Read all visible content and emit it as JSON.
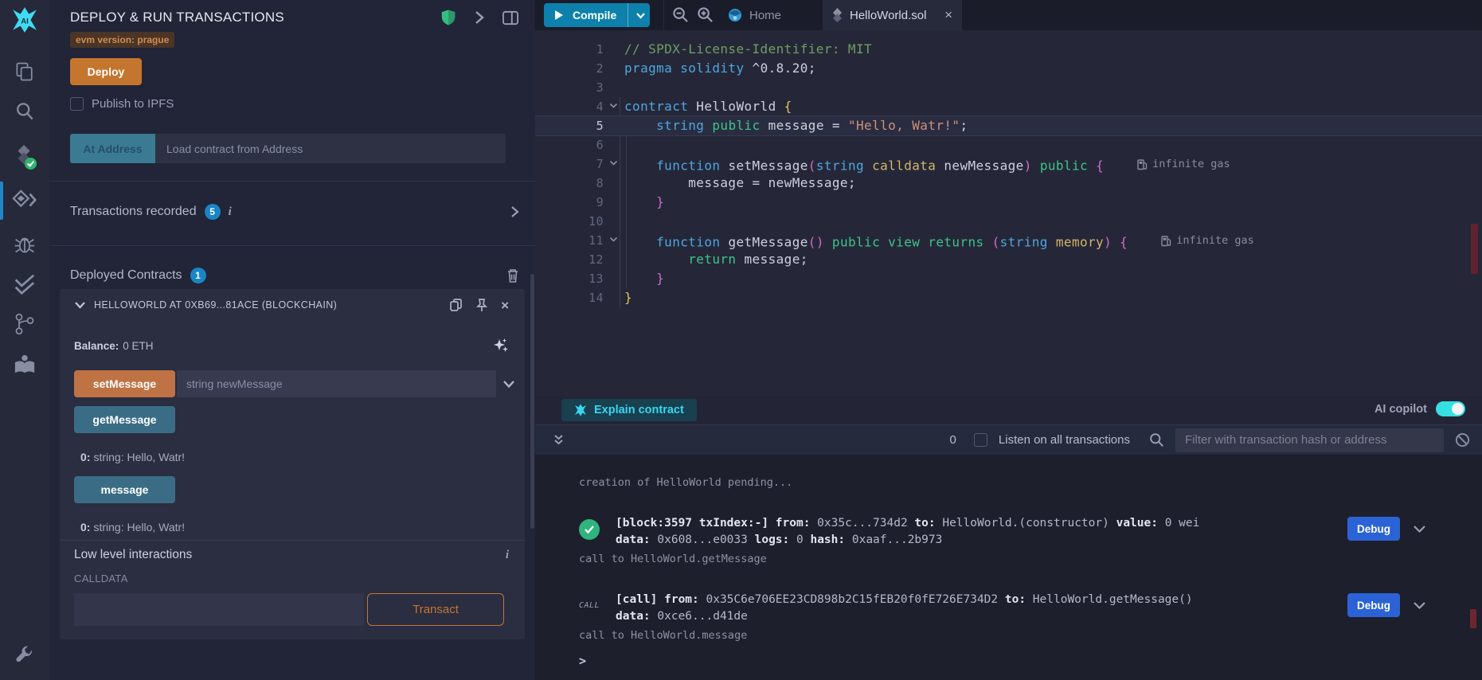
{
  "colors": {
    "accent_orange": "#c4762f",
    "teal_button": "#3a6d85",
    "compile_blue": "#0d81ab",
    "cyan_ai": "#38d6f2",
    "debug_blue": "#2b63d7",
    "badge_blue": "#1a85c4",
    "success_green": "#2eb47c",
    "shield_green": "#35bd81"
  },
  "sidebar": {
    "icons": [
      "remix-ai-logo",
      "file-explorer",
      "search",
      "solidity-compiler",
      "deploy-and-run",
      "debugger",
      "static-analysis",
      "git",
      "learneth",
      "settings-wrench"
    ],
    "active_item": "deploy-and-run"
  },
  "panel": {
    "title": "DEPLOY & RUN TRANSACTIONS",
    "header_icons": [
      "shield-icon",
      "chevron-right-icon",
      "columns-icon"
    ],
    "evm_badge": "evm version: prague",
    "deploy_label": "Deploy",
    "publish_label": "Publish to IPFS",
    "at_address_label": "At Address",
    "at_address_placeholder": "Load contract from Address",
    "transactions_recorded": {
      "label": "Transactions recorded",
      "count": "5",
      "info_glyph": "i"
    },
    "deployed_contracts": {
      "label": "Deployed Contracts",
      "count": "1"
    },
    "contract": {
      "header": "HELLOWORLD AT 0XB69...81ACE (BLOCKCHAIN)",
      "balance_label": "Balance:",
      "balance_value": "0 ETH",
      "set_message_label": "setMessage",
      "set_message_placeholder": "string newMessage",
      "get_message_label": "getMessage",
      "get_message_result_index": "0:",
      "get_message_result": "string: Hello, Watr!",
      "message_label": "message",
      "message_result_index": "0:",
      "message_result": "string: Hello, Watr!",
      "low_level_label": "Low level interactions",
      "low_level_info_glyph": "i",
      "calldata_label": "CALLDATA",
      "transact_label": "Transact"
    }
  },
  "tabbar": {
    "compile_label": "Compile",
    "home_label": "Home",
    "file_label": "HelloWorld.sol",
    "close_glyph": "×",
    "icons": [
      "play-icon",
      "chevron-down-icon",
      "zoom-out-icon",
      "zoom-in-icon",
      "remix-home-icon",
      "solidity-file-icon",
      "close-icon"
    ]
  },
  "editor": {
    "active_line": 5,
    "fold_lines": [
      4,
      7,
      11
    ],
    "gas_lines": [
      7,
      11
    ],
    "gas_label": "infinite gas",
    "lines": [
      {
        "n": 1,
        "segs": [
          [
            "// SPDX-License-Identifier: MIT",
            "tok-com"
          ]
        ]
      },
      {
        "n": 2,
        "segs": [
          [
            "pragma solidity ",
            "tok-kw"
          ],
          [
            "^0.8.20;",
            ""
          ]
        ]
      },
      {
        "n": 3,
        "segs": []
      },
      {
        "n": 4,
        "segs": [
          [
            "contract ",
            "tok-kw"
          ],
          [
            "HelloWorld ",
            ""
          ],
          [
            "{",
            "tok-yel"
          ]
        ]
      },
      {
        "n": 5,
        "segs": [
          [
            "    ",
            ""
          ],
          [
            "string",
            "tok-kw"
          ],
          [
            " ",
            ""
          ],
          [
            "public",
            "tok-grn"
          ],
          [
            " message = ",
            ""
          ],
          [
            "\"Hello, Watr!\"",
            "tok-str"
          ],
          [
            ";",
            ""
          ]
        ]
      },
      {
        "n": 6,
        "segs": []
      },
      {
        "n": 7,
        "segs": [
          [
            "    ",
            ""
          ],
          [
            "function",
            "tok-kw"
          ],
          [
            " setMessage",
            ""
          ],
          [
            "(",
            "tok-mag"
          ],
          [
            "string",
            "tok-kw"
          ],
          [
            " ",
            ""
          ],
          [
            "calldata",
            "tok-khk"
          ],
          [
            " newMessage",
            ""
          ],
          [
            ")",
            "tok-mag"
          ],
          [
            " ",
            ""
          ],
          [
            "public",
            "tok-grn"
          ],
          [
            " ",
            ""
          ],
          [
            "{",
            "tok-mag"
          ]
        ]
      },
      {
        "n": 8,
        "segs": [
          [
            "        message = newMessage;",
            ""
          ]
        ]
      },
      {
        "n": 9,
        "segs": [
          [
            "    ",
            ""
          ],
          [
            "}",
            "tok-mag"
          ]
        ]
      },
      {
        "n": 10,
        "segs": []
      },
      {
        "n": 11,
        "segs": [
          [
            "    ",
            ""
          ],
          [
            "function",
            "tok-kw"
          ],
          [
            " getMessage",
            ""
          ],
          [
            "()",
            "tok-mag"
          ],
          [
            " ",
            ""
          ],
          [
            "public view returns",
            "tok-grn"
          ],
          [
            " ",
            ""
          ],
          [
            "(",
            "tok-mag"
          ],
          [
            "string",
            "tok-kw"
          ],
          [
            " ",
            ""
          ],
          [
            "memory",
            "tok-khk"
          ],
          [
            ")",
            "tok-mag"
          ],
          [
            " ",
            ""
          ],
          [
            "{",
            "tok-mag"
          ]
        ]
      },
      {
        "n": 12,
        "segs": [
          [
            "        ",
            ""
          ],
          [
            "return",
            "tok-grn"
          ],
          [
            " message;",
            ""
          ]
        ]
      },
      {
        "n": 13,
        "segs": [
          [
            "    ",
            ""
          ],
          [
            "}",
            "tok-mag"
          ]
        ]
      },
      {
        "n": 14,
        "segs": [
          [
            "}",
            "tok-yel"
          ]
        ]
      }
    ]
  },
  "explain": {
    "button_label": "Explain contract",
    "ai_label": "AI copilot",
    "toggle_state": "on"
  },
  "terminal": {
    "count": "0",
    "listen_label": "Listen on all transactions",
    "filter_placeholder": "Filter with transaction hash or address",
    "icons": [
      "double-chevron-down-icon",
      "search-icon",
      "ban-icon"
    ],
    "debug_label": "Debug",
    "entries": [
      {
        "kind": "muted",
        "text": "creation of HelloWorld pending..."
      },
      {
        "kind": "tx",
        "icon": "success-check",
        "lines": [
          [
            [
              "[block:3597 txIndex:-] ",
              1
            ],
            [
              "from:",
              1
            ],
            [
              " 0x35c...734d2 ",
              0
            ],
            [
              "to:",
              1
            ],
            [
              " HelloWorld.(constructor) ",
              0
            ],
            [
              "value:",
              1
            ],
            [
              " 0 wei",
              0
            ]
          ],
          [
            [
              "data:",
              1
            ],
            [
              " 0x608...e0033 ",
              0
            ],
            [
              "logs:",
              1
            ],
            [
              " 0 ",
              0
            ],
            [
              "hash:",
              1
            ],
            [
              " 0xaaf...2b973",
              0
            ]
          ]
        ]
      },
      {
        "kind": "muted",
        "text": "call to HelloWorld.getMessage"
      },
      {
        "kind": "tx",
        "icon": "call-tag",
        "tag": "CALL",
        "lines": [
          [
            [
              "[call] ",
              1
            ],
            [
              "from:",
              1
            ],
            [
              " 0x35C6e706EE23CD898b2C15fEB20f0fE726E734D2 ",
              0
            ],
            [
              "to:",
              1
            ],
            [
              " HelloWorld.getMessage()",
              0
            ]
          ],
          [
            [
              "data:",
              1
            ],
            [
              " 0xce6...d41de",
              0
            ]
          ]
        ]
      },
      {
        "kind": "muted",
        "text": "call to HelloWorld.message"
      },
      {
        "kind": "prompt",
        "text": ">"
      }
    ]
  }
}
